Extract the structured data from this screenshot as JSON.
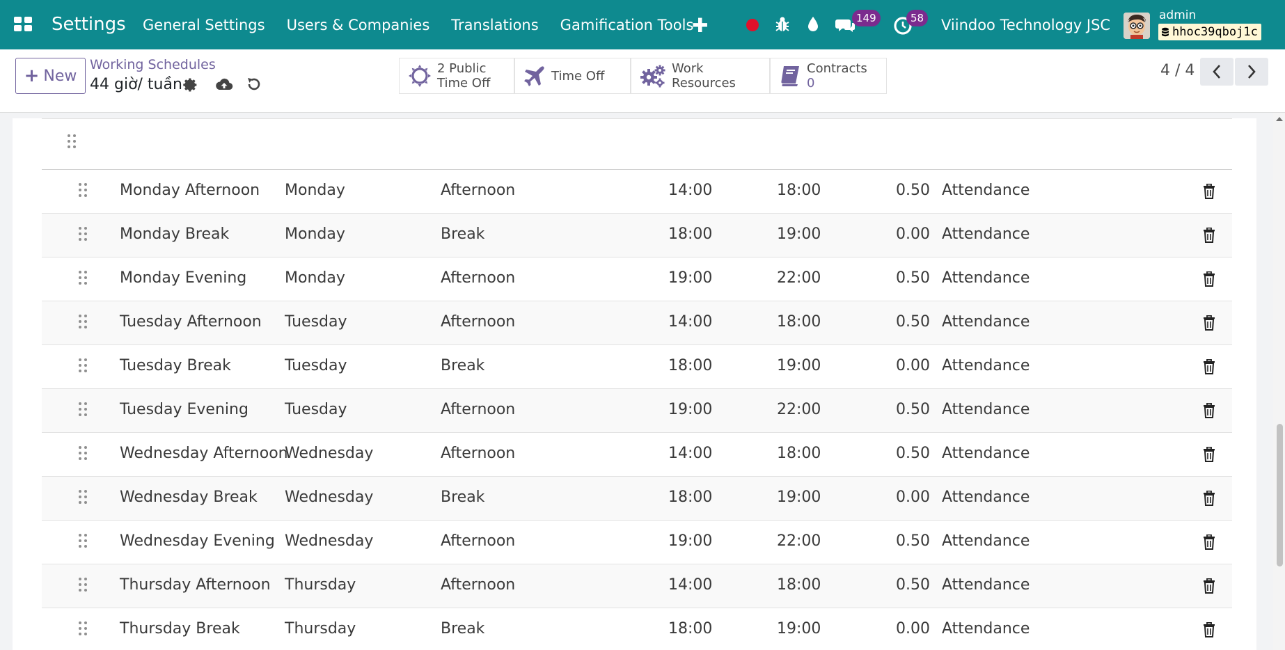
{
  "navbar": {
    "title": "Settings",
    "menu": [
      "General Settings",
      "Users & Companies",
      "Translations",
      "Gamification Tools"
    ],
    "messages_count": "149",
    "activities_count": "58",
    "company": "Viindoo Technology JSC",
    "user": "admin",
    "database": "hhoc39qboj1c",
    "bg_color": "#0e8a8f"
  },
  "control": {
    "new_label": "New",
    "breadcrumb_parent": "Working Schedules",
    "breadcrumb_current": "44 giờ/ tuần",
    "smart_buttons": [
      {
        "line1": "2 Public",
        "line2": "Time Off",
        "icon": "sun-icon"
      },
      {
        "line1": "Time Off",
        "icon": "plane-icon"
      },
      {
        "line1": "Work Resources",
        "icon": "gears-icon"
      },
      {
        "line1": "Contracts",
        "line2": "0",
        "icon": "book-icon"
      }
    ],
    "pager": "4 / 4"
  },
  "attendances": [
    {
      "name": "Monday Afternoon",
      "day": "Monday",
      "period": "Afternoon",
      "from": "14:00",
      "to": "18:00",
      "duration": "0.50",
      "type": "Attendance"
    },
    {
      "name": "Monday Break",
      "day": "Monday",
      "period": "Break",
      "from": "18:00",
      "to": "19:00",
      "duration": "0.00",
      "type": "Attendance"
    },
    {
      "name": "Monday Evening",
      "day": "Monday",
      "period": "Afternoon",
      "from": "19:00",
      "to": "22:00",
      "duration": "0.50",
      "type": "Attendance"
    },
    {
      "name": "Tuesday Afternoon",
      "day": "Tuesday",
      "period": "Afternoon",
      "from": "14:00",
      "to": "18:00",
      "duration": "0.50",
      "type": "Attendance"
    },
    {
      "name": "Tuesday Break",
      "day": "Tuesday",
      "period": "Break",
      "from": "18:00",
      "to": "19:00",
      "duration": "0.00",
      "type": "Attendance"
    },
    {
      "name": "Tuesday Evening",
      "day": "Tuesday",
      "period": "Afternoon",
      "from": "19:00",
      "to": "22:00",
      "duration": "0.50",
      "type": "Attendance"
    },
    {
      "name": "Wednesday Afternoon",
      "day": "Wednesday",
      "period": "Afternoon",
      "from": "14:00",
      "to": "18:00",
      "duration": "0.50",
      "type": "Attendance"
    },
    {
      "name": "Wednesday Break",
      "day": "Wednesday",
      "period": "Break",
      "from": "18:00",
      "to": "19:00",
      "duration": "0.00",
      "type": "Attendance"
    },
    {
      "name": "Wednesday Evening",
      "day": "Wednesday",
      "period": "Afternoon",
      "from": "19:00",
      "to": "22:00",
      "duration": "0.50",
      "type": "Attendance"
    },
    {
      "name": "Thursday Afternoon",
      "day": "Thursday",
      "period": "Afternoon",
      "from": "14:00",
      "to": "18:00",
      "duration": "0.50",
      "type": "Attendance"
    },
    {
      "name": "Thursday Break",
      "day": "Thursday",
      "period": "Break",
      "from": "18:00",
      "to": "19:00",
      "duration": "0.00",
      "type": "Attendance"
    }
  ]
}
